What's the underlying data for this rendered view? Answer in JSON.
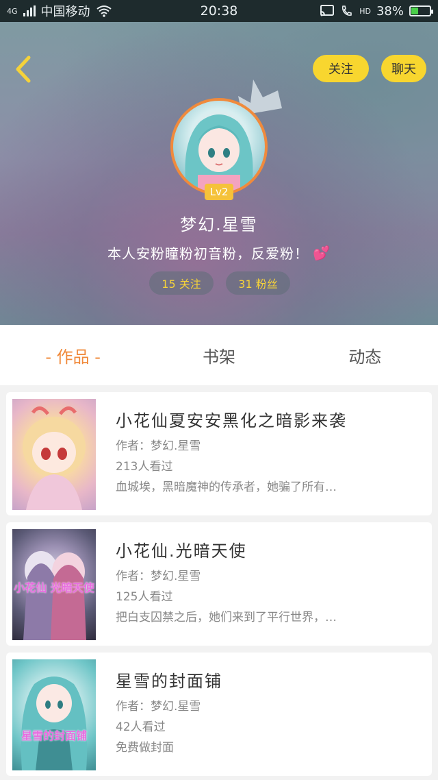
{
  "status_bar": {
    "network": "4G",
    "carrier": "中国移动",
    "time": "20:38",
    "battery": "38%",
    "battery_level": 0.38,
    "hd_label": "HD"
  },
  "header": {
    "follow_button": "关注",
    "chat_button": "聊天",
    "level": "Lv2",
    "username": "梦幻.星雪",
    "bio": "本人安粉瞳粉初音粉，反爱粉！",
    "bio_emoji": "💕",
    "stats": {
      "following": "15 关注",
      "fans": "31 粉丝"
    },
    "accent_color": "#f8d62f",
    "avatar_ring_color": "#f08a3c"
  },
  "tabs": [
    {
      "label": "-  作品  -",
      "active": true
    },
    {
      "label": "书架",
      "active": false
    },
    {
      "label": "动态",
      "active": false
    }
  ],
  "books": [
    {
      "title": "小花仙夏安安黑化之暗影来袭",
      "author": "作者：梦幻.星雪",
      "views": "213人看过",
      "description": "血城埃，黑暗魔神的传承者，她骗了所有…"
    },
    {
      "title": "小花仙.光暗天使",
      "author": "作者：梦幻.星雪",
      "views": "125人看过",
      "description": "把白支囚禁之后，她们来到了平行世界，…"
    },
    {
      "title": "星雪的封面铺",
      "author": "作者：梦幻.星雪",
      "views": "42人看过",
      "description": "免费做封面"
    }
  ],
  "cover_titles": {
    "book2": "小花仙 光暗天使",
    "book3": "星雪的封面铺"
  }
}
